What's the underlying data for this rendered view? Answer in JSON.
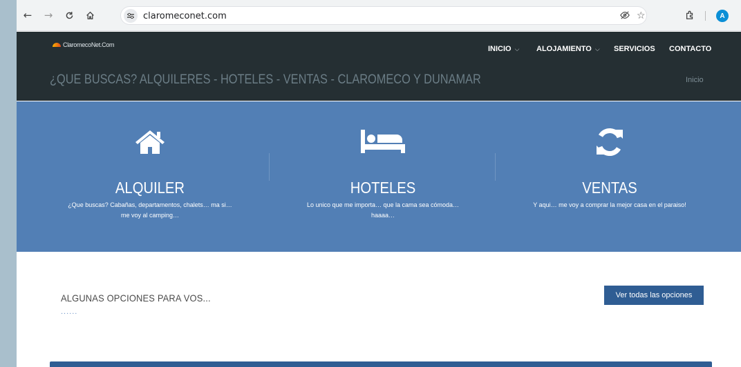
{
  "browser": {
    "url": "claromeconet.com",
    "avatar_letter": "A",
    "icons": [
      "back-icon",
      "forward-icon",
      "reload-icon",
      "home-icon",
      "site-info-icon",
      "eye-off-icon",
      "star-icon",
      "extensions-icon"
    ]
  },
  "header": {
    "logo_text": "ClaromecoNet.Com",
    "nav": {
      "inicio": "INICIO",
      "alojamiento": "ALOJAMIENTO",
      "servicios": "SERVICIOS",
      "contacto": "CONTACTO"
    },
    "banner_title": "¿QUE BUSCAS? ALQUILERES - HOTELES - VENTAS - CLAROMECO Y DUNAMAR",
    "breadcrumb": "Inicio"
  },
  "services": [
    {
      "title": "ALQUILER",
      "desc_line1": "¿Que buscas? Cabañas, departamentos, chalets… ma si…",
      "desc_line2": "me voy al camping…",
      "icon": "home-icon"
    },
    {
      "title": "HOTELES",
      "desc_line1": "Lo unico que me importa… que la cama sea cómoda…",
      "desc_line2": "haaaa…",
      "icon": "bed-icon"
    },
    {
      "title": "VENTAS",
      "desc_line1": "Y aqui… me voy a comprar la mejor casa en el paraiso!",
      "desc_line2": "",
      "icon": "refresh-icon"
    }
  ],
  "options": {
    "title": "ALGUNAS OPCIONES PARA VOS...",
    "dots": "......",
    "button_label": "Ver todas las opciones"
  },
  "colors": {
    "header_bg": "#252f33",
    "services_bg": "#527fb5",
    "button_bg": "#2f5d93"
  }
}
